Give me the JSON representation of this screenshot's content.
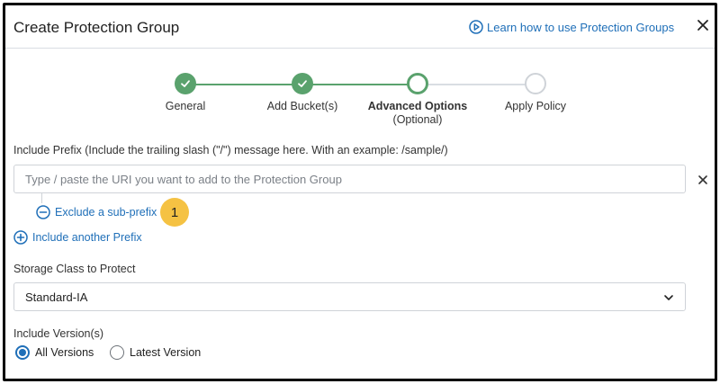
{
  "dialog": {
    "title": "Create Protection Group",
    "learn_link": "Learn how to use Protection Groups"
  },
  "stepper": {
    "steps": [
      {
        "label": "General",
        "sublabel": "",
        "state": "complete"
      },
      {
        "label": "Add Bucket(s)",
        "sublabel": "",
        "state": "complete"
      },
      {
        "label": "Advanced Options",
        "sublabel": "(Optional)",
        "state": "current"
      },
      {
        "label": "Apply Policy",
        "sublabel": "",
        "state": "upcoming"
      }
    ]
  },
  "prefix": {
    "label": "Include Prefix (Include the trailing slash (\"/\") message here. With an example: /sample/)",
    "placeholder": "Type / paste the URI you want to add to the Protection Group",
    "value": "",
    "exclude_link": "Exclude a sub-prefix",
    "include_another_link": "Include another Prefix"
  },
  "callout_badge": "1",
  "storage_class": {
    "label": "Storage Class to Protect",
    "selected": "Standard-IA"
  },
  "versions": {
    "label": "Include Version(s)",
    "options": [
      {
        "label": "All Versions",
        "selected": true
      },
      {
        "label": "Latest Version",
        "selected": false
      }
    ]
  },
  "colors": {
    "accent": "#1f6fb8",
    "step_complete": "#5aa26d",
    "badge": "#f5c243"
  }
}
